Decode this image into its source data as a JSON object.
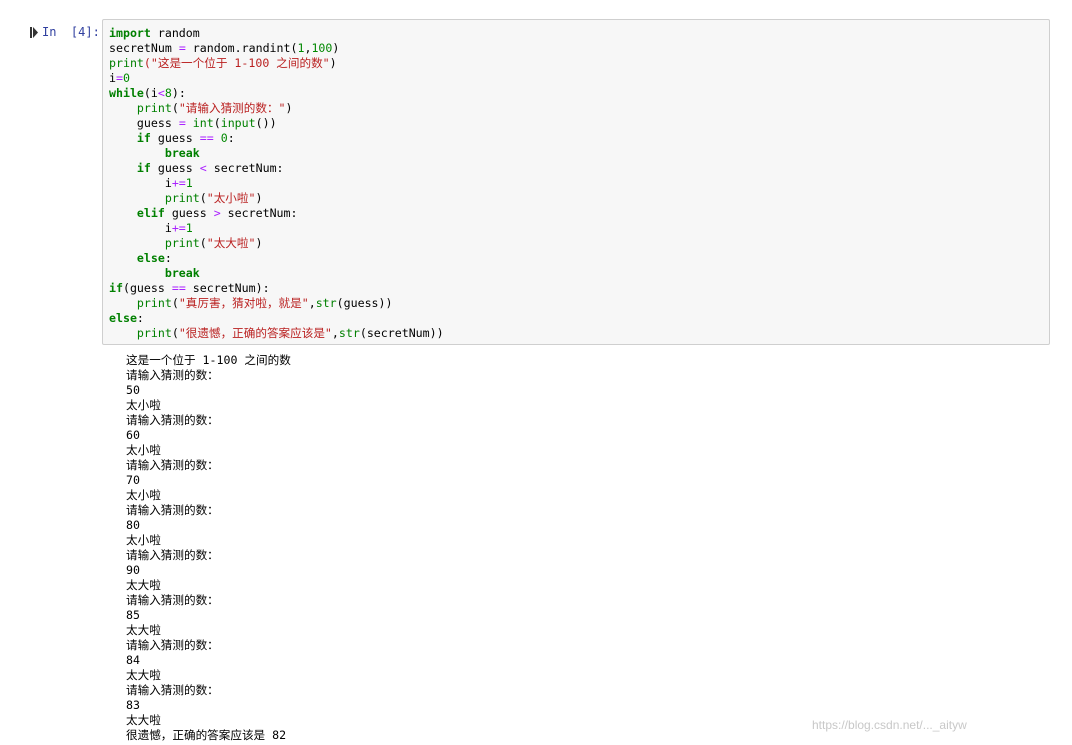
{
  "cell": {
    "prompt": "In  [4]:",
    "code_lines": [
      [
        [
          "kw",
          "import"
        ],
        [
          "t",
          " random"
        ]
      ],
      [
        [
          "t",
          "secretNum "
        ],
        [
          "op",
          "="
        ],
        [
          "t",
          " random.randint("
        ],
        [
          "num",
          "1"
        ],
        [
          "t",
          ","
        ],
        [
          "num",
          "100"
        ],
        [
          "t",
          ")"
        ]
      ],
      [
        [
          "bi",
          "print"
        ],
        [
          "str",
          "(\"这是一个位于 1-100 之间的数\""
        ],
        [
          "t",
          ")"
        ]
      ],
      [
        [
          "t",
          "i"
        ],
        [
          "op",
          "="
        ],
        [
          "num",
          "0"
        ]
      ],
      [
        [
          "kw",
          "while"
        ],
        [
          "t",
          "(i"
        ],
        [
          "op",
          "<"
        ],
        [
          "num",
          "8"
        ],
        [
          "t",
          "):"
        ]
      ],
      [
        [
          "t",
          "    "
        ],
        [
          "bi",
          "print"
        ],
        [
          "t",
          "("
        ],
        [
          "str",
          "\"请输入猜测的数：\""
        ],
        [
          "t",
          ")"
        ]
      ],
      [
        [
          "t",
          "    guess "
        ],
        [
          "op",
          "="
        ],
        [
          "t",
          " "
        ],
        [
          "bi",
          "int"
        ],
        [
          "t",
          "("
        ],
        [
          "bi",
          "input"
        ],
        [
          "t",
          "())"
        ]
      ],
      [
        [
          "t",
          "    "
        ],
        [
          "kw",
          "if"
        ],
        [
          "t",
          " guess "
        ],
        [
          "op",
          "=="
        ],
        [
          "t",
          " "
        ],
        [
          "num",
          "0"
        ],
        [
          "t",
          ":"
        ]
      ],
      [
        [
          "t",
          "        "
        ],
        [
          "kw",
          "break"
        ]
      ],
      [
        [
          "t",
          "    "
        ],
        [
          "kw",
          "if"
        ],
        [
          "t",
          " guess "
        ],
        [
          "op",
          "<"
        ],
        [
          "t",
          " secretNum:"
        ]
      ],
      [
        [
          "t",
          "        i"
        ],
        [
          "op",
          "+="
        ],
        [
          "num",
          "1"
        ]
      ],
      [
        [
          "t",
          "        "
        ],
        [
          "bi",
          "print"
        ],
        [
          "t",
          "("
        ],
        [
          "str",
          "\"太小啦\""
        ],
        [
          "t",
          ")"
        ]
      ],
      [
        [
          "t",
          "    "
        ],
        [
          "kw",
          "elif"
        ],
        [
          "t",
          " guess "
        ],
        [
          "op",
          ">"
        ],
        [
          "t",
          " secretNum:"
        ]
      ],
      [
        [
          "t",
          "        i"
        ],
        [
          "op",
          "+="
        ],
        [
          "num",
          "1"
        ]
      ],
      [
        [
          "t",
          "        "
        ],
        [
          "bi",
          "print"
        ],
        [
          "t",
          "("
        ],
        [
          "str",
          "\"太大啦\""
        ],
        [
          "t",
          ")"
        ]
      ],
      [
        [
          "t",
          "    "
        ],
        [
          "kw",
          "else"
        ],
        [
          "t",
          ":"
        ]
      ],
      [
        [
          "t",
          "        "
        ],
        [
          "kw",
          "break"
        ]
      ],
      [
        [
          "kw",
          "if"
        ],
        [
          "t",
          "(guess "
        ],
        [
          "op",
          "=="
        ],
        [
          "t",
          " secretNum):"
        ]
      ],
      [
        [
          "t",
          "    "
        ],
        [
          "bi",
          "print"
        ],
        [
          "t",
          "("
        ],
        [
          "str",
          "\"真厉害，猜对啦，就是\""
        ],
        [
          "t",
          ","
        ],
        [
          "bi",
          "str"
        ],
        [
          "t",
          "(guess))"
        ]
      ],
      [
        [
          "kw",
          "else"
        ],
        [
          "t",
          ":"
        ]
      ],
      [
        [
          "t",
          "    "
        ],
        [
          "bi",
          "print"
        ],
        [
          "t",
          "("
        ],
        [
          "str",
          "\"很遗憾，正确的答案应该是\""
        ],
        [
          "t",
          ","
        ],
        [
          "bi",
          "str"
        ],
        [
          "t",
          "(secretNum))"
        ]
      ]
    ],
    "output_lines": [
      "这是一个位于 1-100 之间的数",
      "请输入猜测的数：",
      "50",
      "太小啦",
      "请输入猜测的数：",
      "60",
      "太小啦",
      "请输入猜测的数：",
      "70",
      "太小啦",
      "请输入猜测的数：",
      "80",
      "太小啦",
      "请输入猜测的数：",
      "90",
      "太大啦",
      "请输入猜测的数：",
      "85",
      "太大啦",
      "请输入猜测的数：",
      "84",
      "太大啦",
      "请输入猜测的数：",
      "83",
      "太大啦",
      "很遗憾，正确的答案应该是 82"
    ]
  },
  "watermark": "https://blog.csdn.net/..._aityw",
  "colors": {
    "prompt": "#303f9f",
    "keyword": "#008000",
    "string": "#ba2121",
    "operator": "#aa22ff",
    "input_bg": "#f7f7f7",
    "input_border": "#cfcfcf"
  },
  "icons": {
    "run_marker": "run-cell-marker-icon"
  }
}
